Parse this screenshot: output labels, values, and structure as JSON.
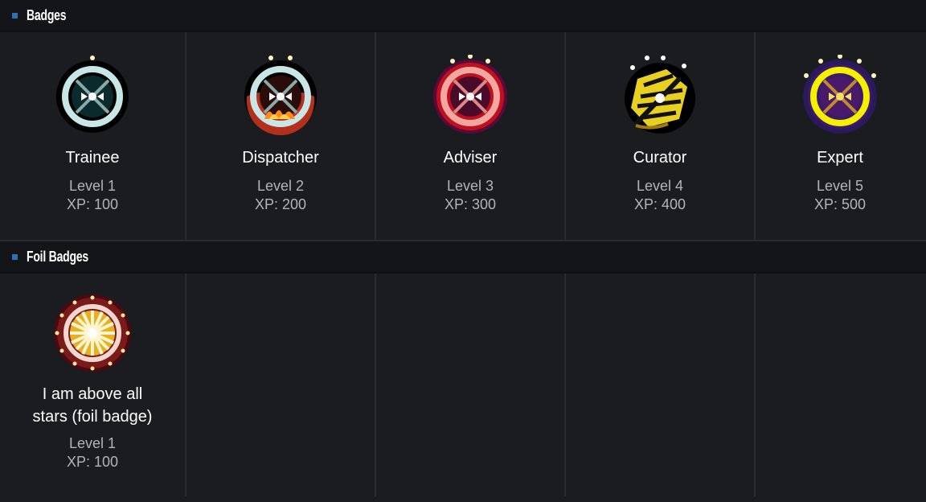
{
  "sections": {
    "badges_title": "Badges",
    "foil_title": "Foil Badges"
  },
  "badges": [
    {
      "name": "Trainee",
      "level": "Level 1",
      "xp": "XP: 100"
    },
    {
      "name": "Dispatcher",
      "level": "Level 2",
      "xp": "XP: 200"
    },
    {
      "name": "Adviser",
      "level": "Level 3",
      "xp": "XP: 300"
    },
    {
      "name": "Curator",
      "level": "Level 4",
      "xp": "XP: 400"
    },
    {
      "name": "Expert",
      "level": "Level 5",
      "xp": "XP: 500"
    }
  ],
  "foil_badges": [
    {
      "name": "I am above all stars (foil badge)",
      "level": "Level 1",
      "xp": "XP: 100"
    }
  ],
  "colors": {
    "accent": "#2f6fb3",
    "background": "#1b1c20",
    "header_bg": "#141518"
  }
}
